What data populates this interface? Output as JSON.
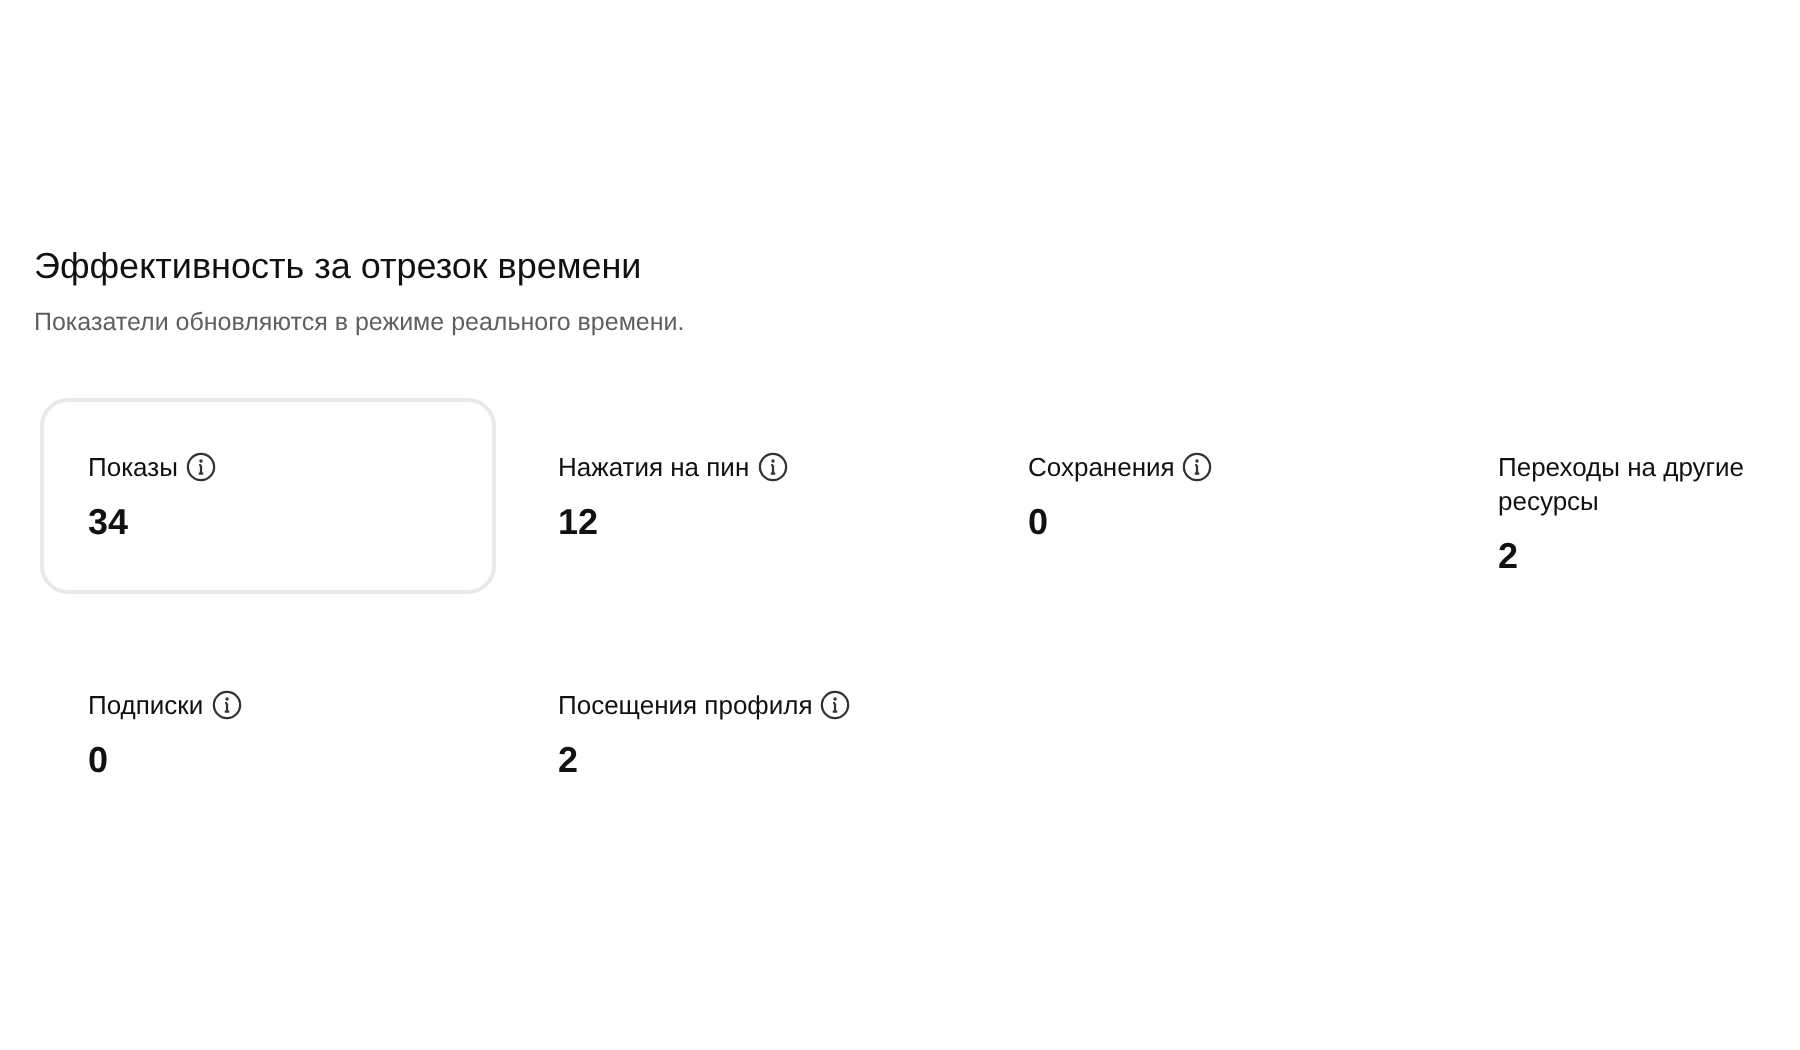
{
  "title": "Эффективность за отрезок времени",
  "subtitle": "Показатели обновляются в режиме реального времени.",
  "metrics": [
    {
      "label": "Показы",
      "value": "34",
      "has_info": true,
      "selected": true
    },
    {
      "label": "Нажатия на пин",
      "value": "12",
      "has_info": true,
      "selected": false
    },
    {
      "label": "Сохранения",
      "value": "0",
      "has_info": true,
      "selected": false
    },
    {
      "label": "Переходы на другие ресурсы",
      "value": "2",
      "has_info": false,
      "selected": false
    },
    {
      "label": "Подписки",
      "value": "0",
      "has_info": true,
      "selected": false
    },
    {
      "label": "Посещения профиля",
      "value": "2",
      "has_info": true,
      "selected": false
    }
  ]
}
